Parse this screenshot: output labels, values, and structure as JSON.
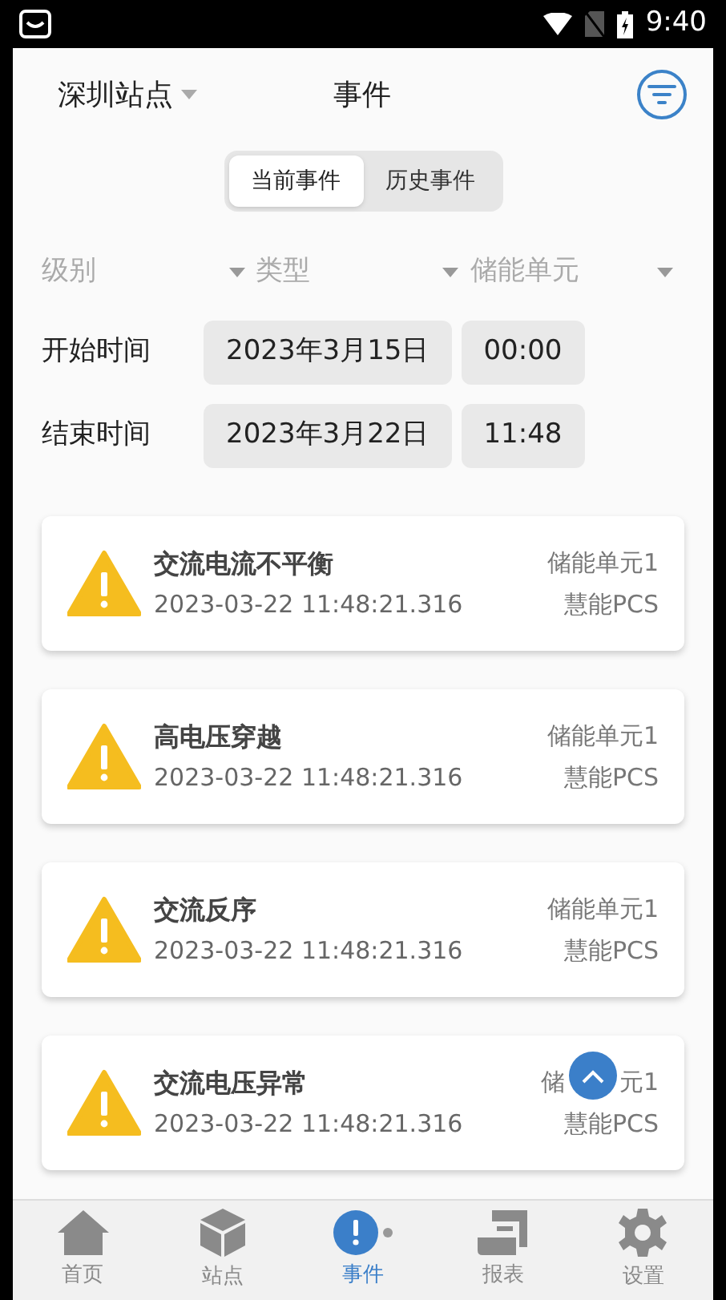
{
  "status_bar": {
    "time": "9:40"
  },
  "header": {
    "site": "深圳站点",
    "title": "事件"
  },
  "segments": [
    {
      "label": "当前事件",
      "selected": true
    },
    {
      "label": "历史事件",
      "selected": false
    }
  ],
  "filters": [
    {
      "label": "级别"
    },
    {
      "label": "类型"
    },
    {
      "label": "储能单元"
    }
  ],
  "time_range": [
    {
      "label": "开始时间",
      "date": "2023年3月15日",
      "time": "00:00"
    },
    {
      "label": "结束时间",
      "date": "2023年3月22日",
      "time": "11:48"
    }
  ],
  "events": [
    {
      "title": "交流电流不平衡",
      "timestamp": "2023-03-22 11:48:21.316",
      "unit": "储能单元1",
      "device": "慧能PCS"
    },
    {
      "title": "高电压穿越",
      "timestamp": "2023-03-22 11:48:21.316",
      "unit": "储能单元1",
      "device": "慧能PCS"
    },
    {
      "title": "交流反序",
      "timestamp": "2023-03-22 11:48:21.316",
      "unit": "储能单元1",
      "device": "慧能PCS"
    },
    {
      "title": "交流电压异常",
      "timestamp": "2023-03-22 11:48:21.316",
      "unit": "储",
      "unit_tail": "元1",
      "device": "慧能PCS"
    }
  ],
  "nav": [
    {
      "kind": "home",
      "label": "首页",
      "selected": false
    },
    {
      "kind": "cube",
      "label": "站点",
      "selected": false
    },
    {
      "kind": "alert",
      "label": "事件",
      "selected": true
    },
    {
      "kind": "report",
      "label": "报表",
      "selected": false
    },
    {
      "kind": "gear",
      "label": "设置",
      "selected": false
    }
  ]
}
